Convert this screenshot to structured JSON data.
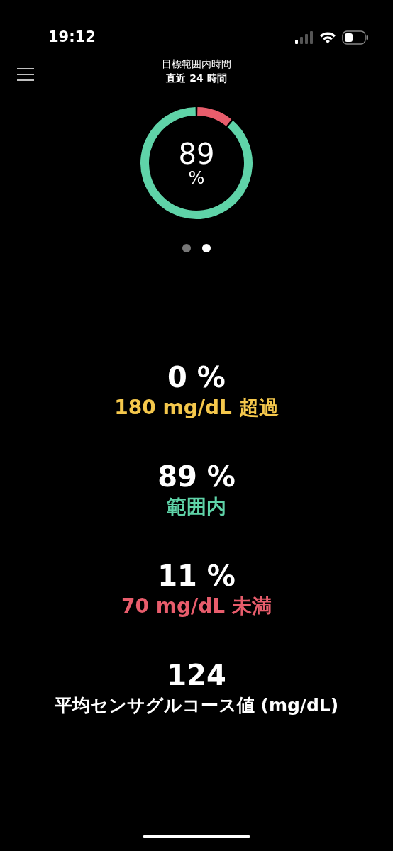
{
  "status_bar": {
    "time": "19:12"
  },
  "header": {
    "title": "目標範囲内時間",
    "subtitle": "直近 24 時間"
  },
  "ring": {
    "value": "89",
    "unit": "%",
    "segments": [
      {
        "color": "#e85d6c"
      },
      {
        "color": "#5fd3a8"
      }
    ]
  },
  "pager": [
    {
      "selected": false
    },
    {
      "selected": true
    }
  ],
  "stats": [
    {
      "value": "0 %",
      "label": "180 mg/dL 超過",
      "color": "#f5c84c"
    },
    {
      "value": "89 %",
      "label": "範囲内",
      "color": "#5fd3a8"
    },
    {
      "value": "11 %",
      "label": "70 mg/dL 未満",
      "color": "#e85d6c"
    },
    {
      "value": "124",
      "label": "平均センサグルコース値 (mg/dL)",
      "color": "#ffffff"
    }
  ]
}
